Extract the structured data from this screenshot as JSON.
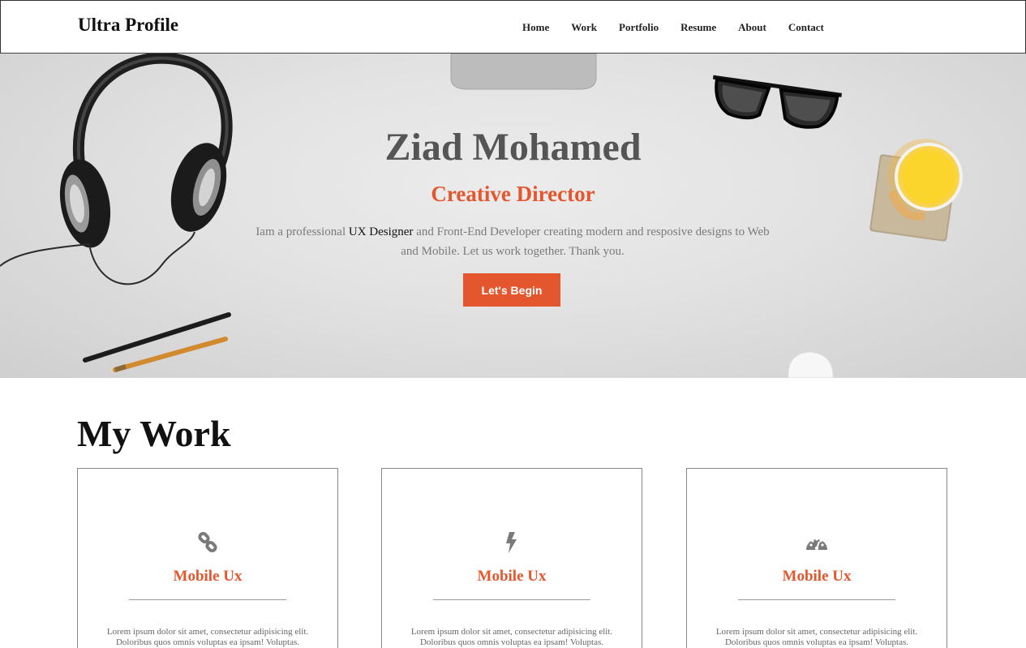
{
  "header": {
    "brand": "Ultra Profile",
    "nav": [
      "Home",
      "Work",
      "Portfolio",
      "Resume",
      "About",
      "Contact"
    ]
  },
  "hero": {
    "name": "Ziad Mohamed",
    "role": "Creative Director",
    "desc_before": "Iam a professional ",
    "desc_highlight": "UX Designer",
    "desc_after": " and Front-End Developer creating modern and resposive designs to Web and Mobile. Let us work together. Thank you.",
    "cta": "Let's Begin"
  },
  "work": {
    "title_light": "My",
    "title_bold": "Work",
    "cards": [
      {
        "icon": "link-icon",
        "title": "Mobile Ux",
        "text": "Lorem ipsum dolor sit amet, consectetur adipisicing elit. Doloribus quos omnis voluptas ea ipsam! Voluptas."
      },
      {
        "icon": "bolt-icon",
        "title": "Mobile Ux",
        "text": "Lorem ipsum dolor sit amet, consectetur adipisicing elit. Doloribus quos omnis voluptas ea ipsam! Voluptas."
      },
      {
        "icon": "dashboard-icon",
        "title": "Mobile Ux",
        "text": "Lorem ipsum dolor sit amet, consectetur adipisicing elit. Doloribus quos omnis voluptas ea ipsam! Voluptas."
      }
    ]
  },
  "colors": {
    "accent": "#e4572e",
    "hero_text": "#555555",
    "icon": "#7a7a7a"
  }
}
